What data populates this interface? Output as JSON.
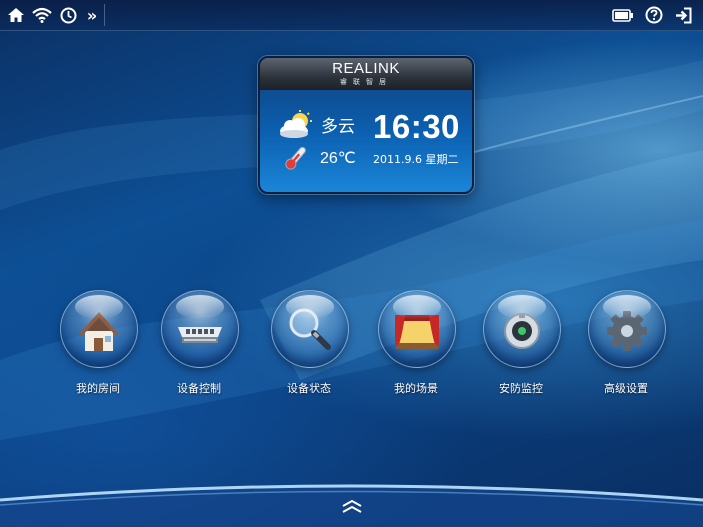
{
  "colors": {
    "accent": "#1a86d8",
    "card_head": "#2d333b",
    "background": "#0d4f94"
  },
  "status_bar": {
    "left_icons": [
      "home-icon",
      "wifi-icon",
      "clock-icon",
      "forward-icon"
    ],
    "forward_glyph": "»",
    "right_icons": [
      "battery-icon",
      "help-icon",
      "exit-icon"
    ]
  },
  "widget": {
    "brand": "REALINK",
    "brand_sub": "睿联智居",
    "weather": "多云",
    "weather_icon": "cloudy-sun-icon",
    "temperature": "26℃",
    "temperature_icon": "thermometer-icon",
    "time": "16:30",
    "date": "2011.9.6 星期二"
  },
  "menu": [
    {
      "label": "我的房间",
      "icon": "house-icon"
    },
    {
      "label": "设备控制",
      "icon": "device-icon"
    },
    {
      "label": "设备状态",
      "icon": "magnifier-icon"
    },
    {
      "label": "我的场景",
      "icon": "stage-icon"
    },
    {
      "label": "安防监控",
      "icon": "camera-icon"
    },
    {
      "label": "高级设置",
      "icon": "gear-icon"
    }
  ],
  "dock": {
    "expand_icon": "chevron-up-icon"
  }
}
